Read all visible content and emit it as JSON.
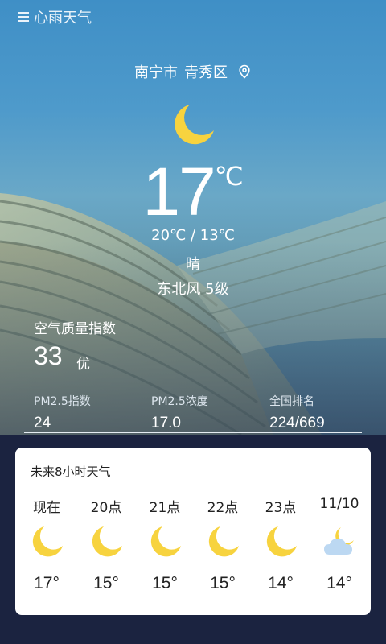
{
  "app": {
    "title": "心雨天气"
  },
  "location": {
    "city": "南宁市",
    "district": "青秀区"
  },
  "current": {
    "icon": "moon-icon",
    "temperature": "17",
    "unit": "℃",
    "range": "20℃  /  13℃",
    "condition": "晴",
    "wind": "东北风   5级"
  },
  "aqi": {
    "title": "空气质量指数",
    "value": "33",
    "level": "优",
    "stats": [
      {
        "label": "PM2.5指数",
        "value": "24"
      },
      {
        "label": "PM2.5浓度",
        "value": "17.0"
      },
      {
        "label": "全国排名",
        "value": "224/669"
      }
    ]
  },
  "hourly": {
    "title": "未来8小时天气",
    "items": [
      {
        "time": "现在",
        "icon": "moon-icon",
        "temp": "17°"
      },
      {
        "time": "20点",
        "icon": "moon-icon",
        "temp": "15°"
      },
      {
        "time": "21点",
        "icon": "moon-icon",
        "temp": "15°"
      },
      {
        "time": "22点",
        "icon": "moon-icon",
        "temp": "15°"
      },
      {
        "time": "23点",
        "icon": "moon-icon",
        "temp": "14°"
      },
      {
        "time": "11/10",
        "icon": "moon-cloud-icon",
        "temp": "14°"
      }
    ]
  },
  "colors": {
    "moon": "#f7d33f",
    "card": "#ffffff",
    "bottom_bg": "#1b2340"
  }
}
